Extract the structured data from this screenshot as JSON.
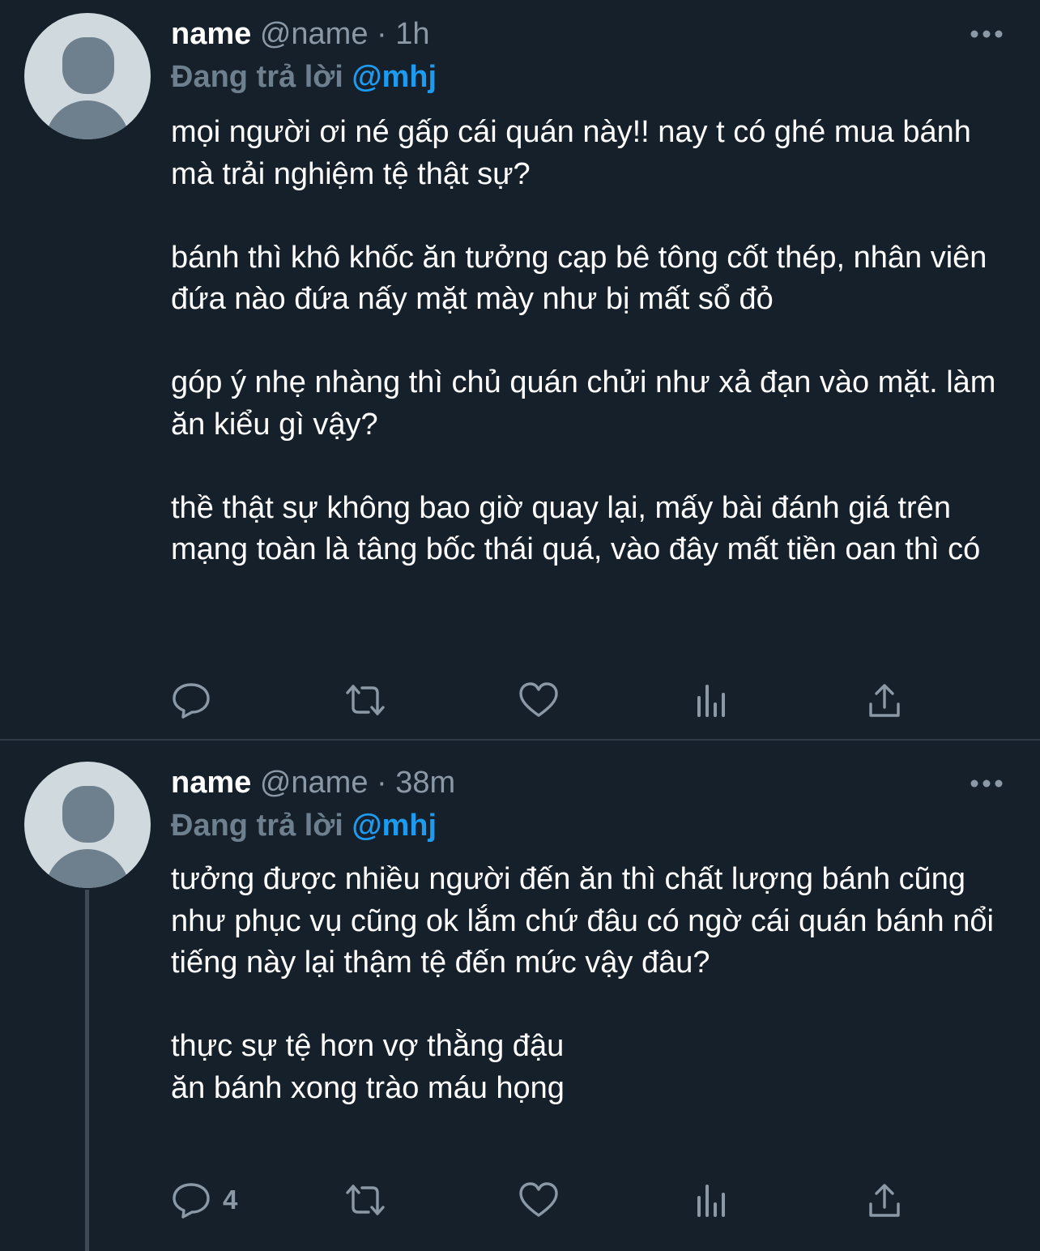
{
  "tweets": [
    {
      "name": "name",
      "handle": "@name",
      "separator": "·",
      "time": "1h",
      "replying_label": "Đang trả lời",
      "replying_to": "@mhj",
      "text": "mọi người ơi né gấp cái quán này!! nay t có ghé mua bánh mà trải nghiệm tệ thật sự?\n\nbánh thì khô khốc ăn tưởng cạp bê tông cốt thép, nhân viên đứa nào đứa nấy mặt mày như bị mất sổ đỏ\n\ngóp ý nhẹ nhàng thì chủ quán chửi như xả đạn vào mặt. làm ăn kiểu gì vậy?\n\nthề thật sự không bao giờ quay lại, mấy bài đánh giá trên mạng toàn là tâng bốc thái quá, vào đây mất tiền oan thì có",
      "reply_count": ""
    },
    {
      "name": "name",
      "handle": "@name",
      "separator": "·",
      "time": "38m",
      "replying_label": "Đang trả lời",
      "replying_to": "@mhj",
      "text": "tưởng được nhiều người đến ăn thì chất lượng bánh cũng như phục vụ cũng ok lắm chứ đâu có ngờ cái quán bánh nổi tiếng này lại thậm tệ đến mức vậy đâu?\n\nthực sự tệ hơn vợ thằng đậu\năn bánh xong trào máu họng",
      "reply_count": "4"
    }
  ],
  "colors": {
    "background": "#15202b",
    "text": "#ffffff",
    "secondary": "#8b98a5",
    "accent": "#1d9bf0",
    "divider": "#2f3b47"
  },
  "icons": [
    "more-icon",
    "reply-icon",
    "retweet-icon",
    "like-icon",
    "views-icon",
    "share-icon"
  ]
}
